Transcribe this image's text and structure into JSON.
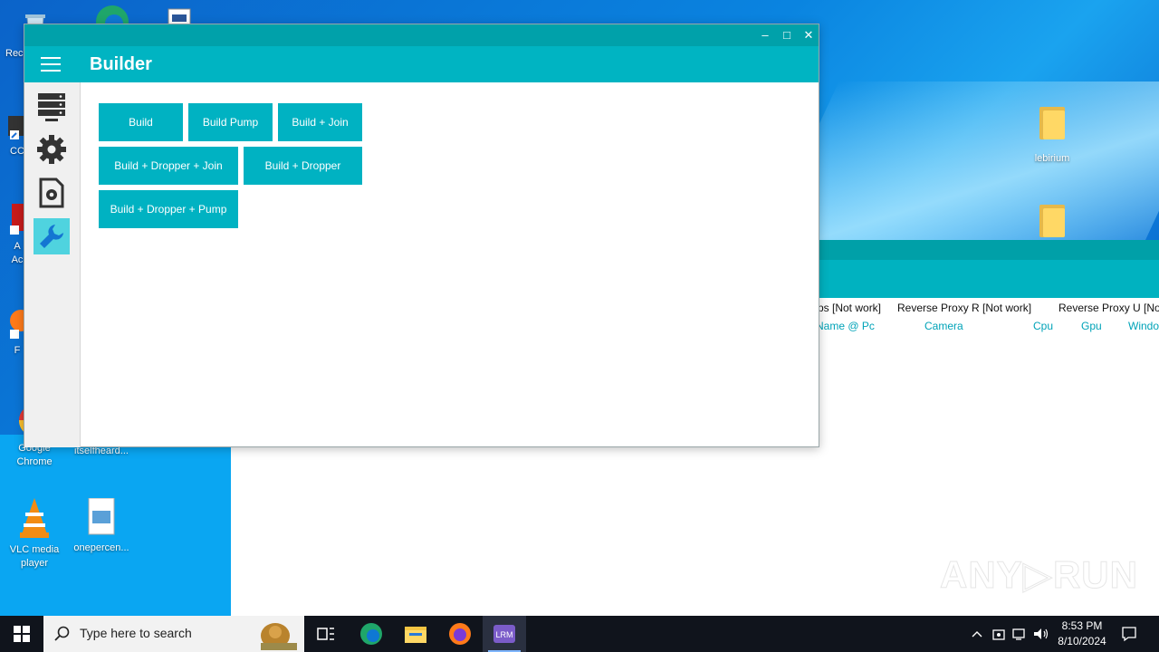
{
  "desktop": {
    "icons": [
      {
        "label": "Rec"
      },
      {
        "label": "CC"
      },
      {
        "label": "A"
      },
      {
        "label": "Ac"
      },
      {
        "label": "F"
      },
      {
        "label": "Google Chrome"
      },
      {
        "label": "itselfheard..."
      },
      {
        "label": "VLC media player"
      },
      {
        "label": "onepercen..."
      },
      {
        "label": "lebirium"
      }
    ]
  },
  "background_window": {
    "columns": [
      "ps [Not work]",
      "Reverse Proxy R [Not work]",
      "Reverse Proxy U [No"
    ],
    "subheaders": [
      "Name @ Pc",
      "Camera",
      "Cpu",
      "Gpu",
      "Windo"
    ]
  },
  "builder_window": {
    "title": "Builder",
    "controls": {
      "minimize": "–",
      "maximize": "□",
      "close": "✕"
    },
    "sidebar": [
      {
        "icon": "server-icon"
      },
      {
        "icon": "gear-icon"
      },
      {
        "icon": "settings-file-icon"
      },
      {
        "icon": "wrench-icon",
        "active": true
      }
    ],
    "buttons": [
      "Build",
      "Build Pump",
      "Build + Join",
      "Build + Dropper + Join",
      "Build + Dropper",
      "Build + Dropper + Pump"
    ]
  },
  "watermark": {
    "text": "ANY▷RUN"
  },
  "taskbar": {
    "search_placeholder": "Type here to search",
    "time": "8:53 PM",
    "date": "8/10/2024",
    "apps": [
      "task-view-icon",
      "edge-icon",
      "file-explorer-icon",
      "firefox-icon",
      "lrm-app-icon"
    ],
    "active_app_label": "LRM"
  },
  "colors": {
    "accent": "#00b4c2",
    "titlebar": "#00a1aa",
    "active_side": "#4fd3df"
  }
}
